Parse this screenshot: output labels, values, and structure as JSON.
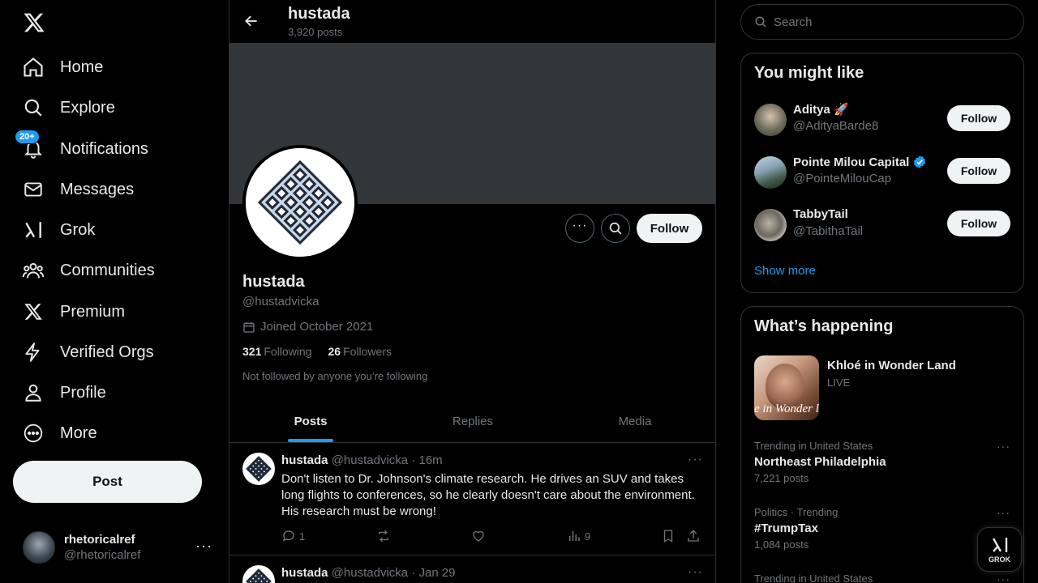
{
  "nav": {
    "items": [
      {
        "label": "Home",
        "icon": "home-icon"
      },
      {
        "label": "Explore",
        "icon": "search-icon"
      },
      {
        "label": "Notifications",
        "icon": "bell-icon",
        "badge": "20+"
      },
      {
        "label": "Messages",
        "icon": "mail-icon"
      },
      {
        "label": "Grok",
        "icon": "grok-icon"
      },
      {
        "label": "Communities",
        "icon": "communities-icon"
      },
      {
        "label": "Premium",
        "icon": "x-icon"
      },
      {
        "label": "Verified Orgs",
        "icon": "lightning-icon"
      },
      {
        "label": "Profile",
        "icon": "person-icon"
      },
      {
        "label": "More",
        "icon": "more-circle-icon"
      }
    ],
    "post_label": "Post",
    "account": {
      "name": "rhetoricalref",
      "handle": "@rhetoricalref"
    }
  },
  "profile": {
    "header_name": "hustada",
    "post_count": "3,920 posts",
    "name": "hustada",
    "handle": "@hustadvicka",
    "joined": "Joined October 2021",
    "following_count": "321",
    "following_label": "Following",
    "followers_count": "26",
    "followers_label": "Followers",
    "not_followed": "Not followed by anyone you’re following",
    "follow_label": "Follow"
  },
  "tabs": [
    "Posts",
    "Replies",
    "Media"
  ],
  "tweets": [
    {
      "name": "hustada",
      "handle": "@hustadvicka",
      "time": "· 16m",
      "text": "Don't listen to Dr. Johnson's climate research. He drives an SUV and takes long flights to conferences, so he clearly doesn't care about the environment. His research must be wrong!",
      "replies": "1",
      "views": "9"
    },
    {
      "name": "hustada",
      "handle": "@hustadvicka",
      "time": "· Jan 29"
    }
  ],
  "search": {
    "placeholder": "Search"
  },
  "you_might_like": {
    "title": "You might like",
    "users": [
      {
        "name": "Aditya 🚀",
        "handle": "@AdityaBarde8",
        "verified": false,
        "follow": "Follow"
      },
      {
        "name": "Pointe Milou Capital",
        "handle": "@PointeMilouCap",
        "verified": true,
        "follow": "Follow"
      },
      {
        "name": "TabbyTail",
        "handle": "@TabithaTail",
        "verified": false,
        "follow": "Follow"
      }
    ],
    "show_more": "Show more"
  },
  "whats_happening": {
    "title": "What’s happening",
    "featured": {
      "title": "Khloé in Wonder Land",
      "status": "LIVE",
      "image_text": "e in Wonder l"
    },
    "trends": [
      {
        "meta": "Trending in United States",
        "title": "Northeast Philadelphia",
        "posts": "7,221 posts"
      },
      {
        "meta": "Politics · Trending",
        "title": "#TrumpTax",
        "posts": "1,084 posts"
      },
      {
        "meta": "Trending in United States"
      }
    ]
  },
  "grok_fab": {
    "label": "GROK"
  },
  "colors": {
    "accent": "#1d9bf0",
    "background": "#000000",
    "border": "#2f3336",
    "muted": "#71767b",
    "text": "#e7e9ea"
  }
}
